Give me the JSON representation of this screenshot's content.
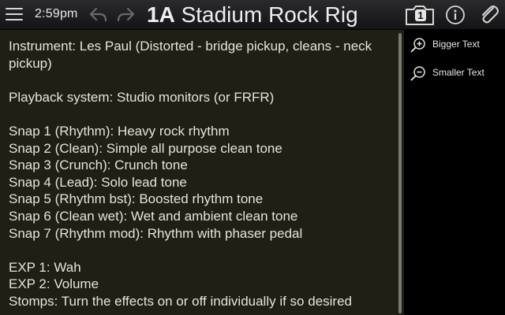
{
  "topbar": {
    "menu_icon": "hamburger-menu-icon",
    "time": "2:59pm",
    "undo_icon": "undo-arrow-icon",
    "redo_icon": "redo-arrow-icon",
    "preset_number": "1A",
    "preset_name": "Stadium Rock Rig",
    "snapshot_icon": "snapshot-icon",
    "snapshot_number": "1",
    "info_icon": "info-icon",
    "attach_icon": "paperclip-icon"
  },
  "notes": {
    "lines": [
      "Instrument: Les Paul (Distorted - bridge pickup, cleans - neck pickup)",
      "",
      "Playback system: Studio monitors (or FRFR)",
      "",
      "Snap 1 (Rhythm): Heavy rock rhythm",
      "Snap 2 (Clean): Simple all purpose clean tone",
      "Snap 3 (Crunch): Crunch tone",
      "Snap 4 (Lead): Solo lead tone",
      "Snap 5 (Rhythm bst): Boosted rhythm tone",
      "Snap 6 (Clean wet): Wet and ambient clean tone",
      "Snap 7 (Rhythm mod): Rhythm with phaser pedal",
      "",
      "EXP 1: Wah",
      "EXP 2: Volume",
      "Stomps: Turn the effects on or off individually if so desired"
    ]
  },
  "side_panel": {
    "bigger_text_label": "Bigger Text",
    "bigger_text_icon": "zoom-in-icon",
    "smaller_text_label": "Smaller Text",
    "smaller_text_icon": "zoom-out-icon"
  },
  "colors": {
    "topbar_bg": "#1c1c1e",
    "notes_bg": "#1f1f16",
    "notes_text": "#e4e4dc",
    "side_bg": "#000000",
    "icon": "#d8d8d8",
    "disabled_icon": "#6a6a6a"
  }
}
